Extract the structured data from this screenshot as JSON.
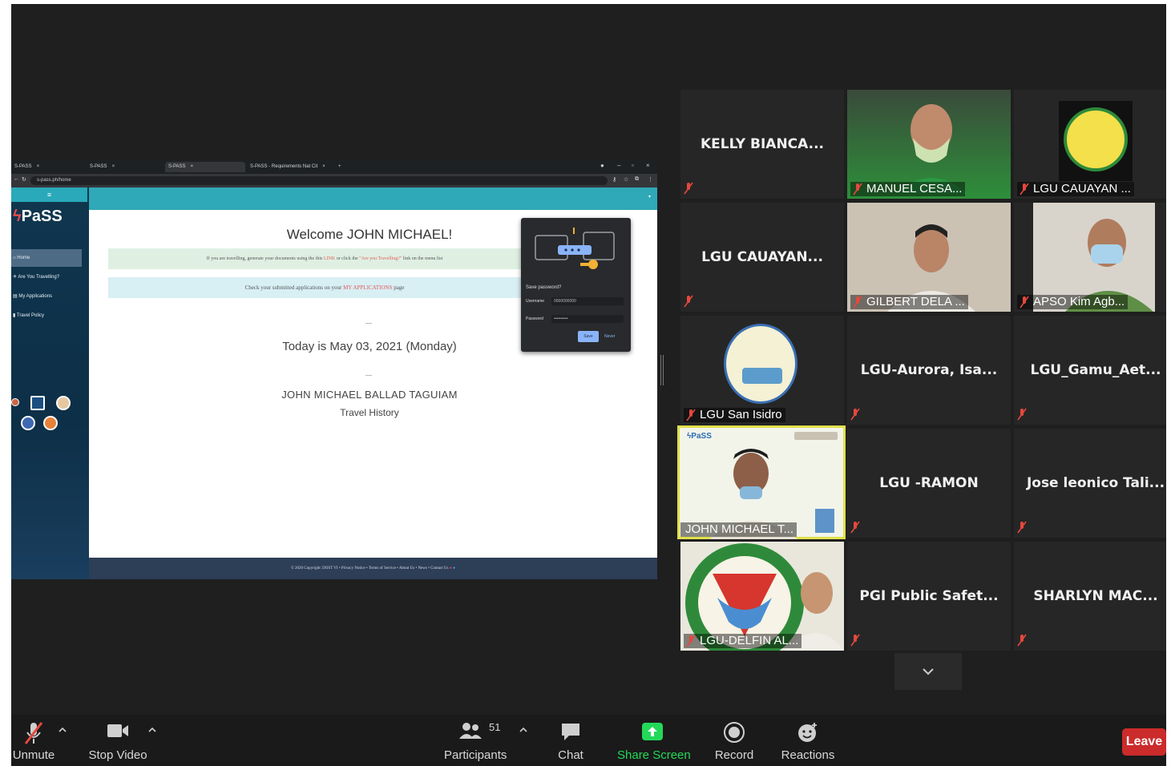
{
  "browser": {
    "tabs": [
      {
        "label": "S-PASS"
      },
      {
        "label": "S-PASS"
      },
      {
        "label": "S-PASS",
        "active": true
      },
      {
        "label": "S-PASS - Requirements Nat Cit"
      }
    ],
    "url": "s-pass.ph/home"
  },
  "spass": {
    "brand": "PaSS",
    "menu_icon": "≡",
    "nav": [
      {
        "label": "Home",
        "active": true
      },
      {
        "label": "Are You Travelling?"
      },
      {
        "label": "My Applications"
      },
      {
        "label": "Travel Policy"
      }
    ],
    "welcome": "Welcome JOHN MICHAEL!",
    "notice_1": "If you are travelling, generate your documents using the this",
    "notice_1_link1": "LINK",
    "notice_1_mid": "or click the",
    "notice_1_link2": "\"Are you Travelling?\"",
    "notice_1_end": "link on the menu list",
    "notice_2": "Check your submitted applications on your",
    "notice_2_link": "MY APPLICATIONS",
    "notice_2_end": "page",
    "today": "Today is May 03, 2021 (Monday)",
    "full_name": "JOHN MICHAEL BALLAD TAGUIAM",
    "travel_history": "Travel History",
    "footer": "© 2020 Copyright: DOST VI • Privacy Notice • Terms of Service • About Us • News • Contact Us"
  },
  "password_popup": {
    "title": "Save password?",
    "username_label": "Username",
    "username_value": "0000000000",
    "password_label": "Password",
    "password_value": "••••••••••",
    "save": "Save",
    "never": "Never"
  },
  "participants": [
    {
      "name": "KELLY BIANCA...",
      "type": "name"
    },
    {
      "name": "MANUEL CESA...",
      "type": "video"
    },
    {
      "name": "LGU CAUAYAN ...",
      "type": "video"
    },
    {
      "name": "LGU CAUAYAN...",
      "type": "name"
    },
    {
      "name": "GILBERT DELA ...",
      "type": "video"
    },
    {
      "name": "APSO Kim Agb...",
      "type": "video"
    },
    {
      "name": "LGU San Isidro",
      "type": "video"
    },
    {
      "name": "LGU-Aurora, Isa...",
      "type": "name"
    },
    {
      "name": "LGU_Gamu_Aet...",
      "type": "name"
    },
    {
      "name": "JOHN MICHAEL T...",
      "type": "video"
    },
    {
      "name": "LGU -RAMON",
      "type": "name"
    },
    {
      "name": "Jose leonico Tali...",
      "type": "name"
    },
    {
      "name": "LGU-DELFIN AL...",
      "type": "video"
    },
    {
      "name": "PGI Public Safet...",
      "type": "name"
    },
    {
      "name": "SHARLYN MAC...",
      "type": "name"
    }
  ],
  "toolbar": {
    "unmute": "Unmute",
    "stop_video": "Stop Video",
    "participants": "Participants",
    "participants_count": "51",
    "chat": "Chat",
    "share_screen": "Share Screen",
    "record": "Record",
    "reactions": "Reactions",
    "leave": "Leave"
  },
  "colors": {
    "share_green": "#23d959",
    "leave_red": "#cc2b2b",
    "mic_muted": "#e5483d",
    "active_speaker": "#e0e04a",
    "spass_teal": "#2fa8b8"
  }
}
